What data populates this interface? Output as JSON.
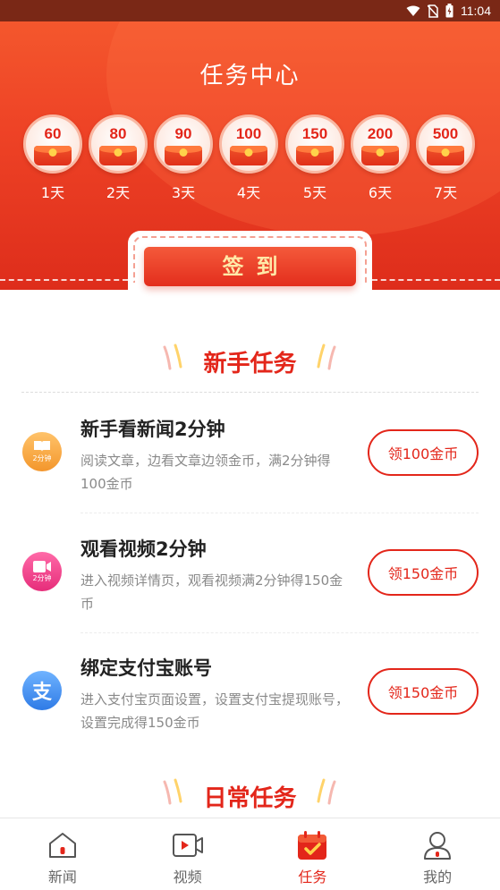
{
  "status_bar": {
    "time": "11:04"
  },
  "header": {
    "title": "任务中心"
  },
  "checkin": {
    "days": [
      {
        "amount": "60",
        "label": "1天"
      },
      {
        "amount": "80",
        "label": "2天"
      },
      {
        "amount": "90",
        "label": "3天"
      },
      {
        "amount": "100",
        "label": "4天"
      },
      {
        "amount": "150",
        "label": "5天"
      },
      {
        "amount": "200",
        "label": "6天"
      },
      {
        "amount": "500",
        "label": "7天"
      }
    ],
    "sign_label": "签到"
  },
  "newbie": {
    "title": "新手任务",
    "tasks": [
      {
        "title": "新手看新闻2分钟",
        "desc": "阅读文章，边看文章边领金币，满2分钟得100金币",
        "button": "领100金币",
        "icon": "book-icon",
        "icon_badge": "2分钟",
        "icon_color": "#f6a13a"
      },
      {
        "title": "观看视频2分钟",
        "desc": "进入视频详情页，观看视频满2分钟得150金币",
        "button": "领150金币",
        "icon": "video-camera-icon",
        "icon_badge": "2分钟",
        "icon_color": "#f03e8a"
      },
      {
        "title": "绑定支付宝账号",
        "desc": "进入支付宝页面设置，设置支付宝提现账号，设置完成得150金币",
        "button": "领150金币",
        "icon": "alipay-icon",
        "icon_badge": "支",
        "icon_color": "#3d8bf0"
      }
    ]
  },
  "daily": {
    "title": "日常任务"
  },
  "bottom_nav": {
    "items": [
      {
        "label": "新闻",
        "icon": "home-icon"
      },
      {
        "label": "视频",
        "icon": "video-icon"
      },
      {
        "label": "任务",
        "icon": "calendar-check-icon",
        "active": true
      },
      {
        "label": "我的",
        "icon": "user-icon"
      }
    ]
  },
  "colors": {
    "primary": "#e3261a",
    "header": "#ee4326"
  }
}
